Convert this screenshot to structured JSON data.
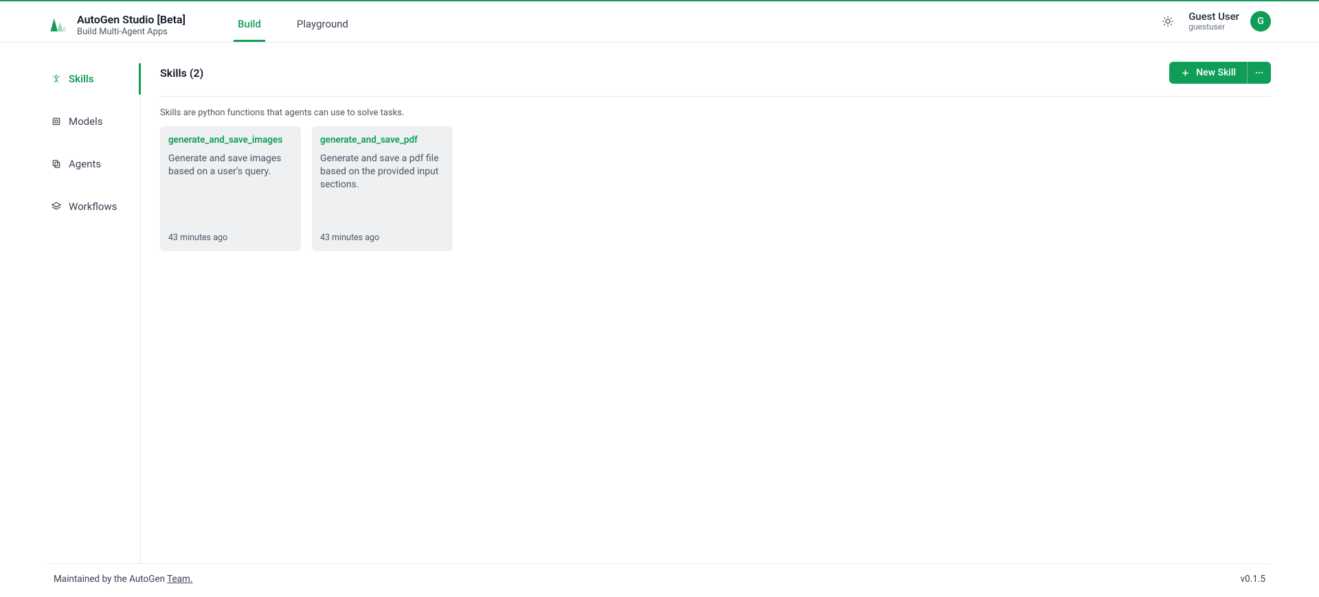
{
  "colors": {
    "accent": "#0f9d58"
  },
  "header": {
    "title": "AutoGen Studio [Beta]",
    "subtitle": "Build Multi-Agent Apps",
    "tabs": [
      {
        "label": "Build",
        "active": true
      },
      {
        "label": "Playground",
        "active": false
      }
    ],
    "user": {
      "name": "Guest User",
      "handle": "guestuser",
      "initial": "G"
    }
  },
  "sidebar": {
    "items": [
      {
        "label": "Skills",
        "icon": "skill-icon",
        "active": true
      },
      {
        "label": "Models",
        "icon": "models-icon",
        "active": false
      },
      {
        "label": "Agents",
        "icon": "agents-icon",
        "active": false
      },
      {
        "label": "Workflows",
        "icon": "workflows-icon",
        "active": false
      }
    ]
  },
  "page": {
    "heading": "Skills (2)",
    "new_button": "New Skill",
    "description": "Skills are python functions that agents can use to solve tasks.",
    "cards": [
      {
        "title": "generate_and_save_images",
        "desc": "Generate and save images based on a user's query.",
        "time": "43 minutes ago"
      },
      {
        "title": "generate_and_save_pdf",
        "desc": "Generate and save a pdf file based on the provided input sections.",
        "time": "43 minutes ago"
      }
    ]
  },
  "footer": {
    "text_prefix": "Maintained by the AutoGen ",
    "team_link": "Team.",
    "version": "v0.1.5"
  }
}
